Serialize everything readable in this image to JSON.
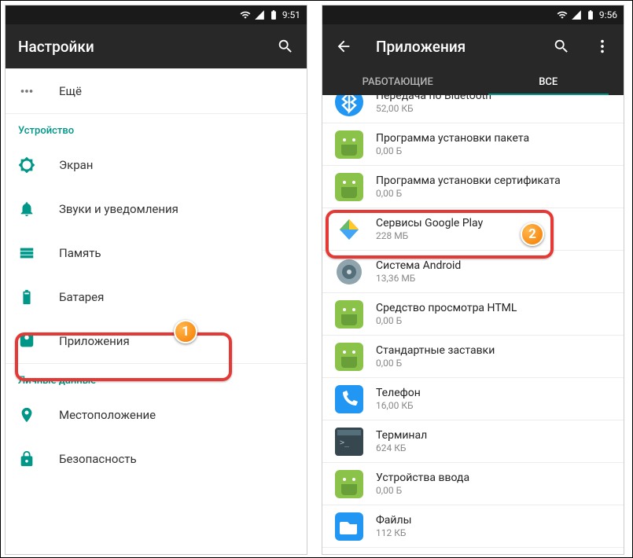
{
  "left": {
    "statusbar": {
      "time": "9:51"
    },
    "toolbar": {
      "title": "Настройки"
    },
    "list": {
      "more_label": "Ещё",
      "section_device": "Устройство",
      "items_device": [
        {
          "label": "Экран"
        },
        {
          "label": "Звуки и уведомления"
        },
        {
          "label": "Память"
        },
        {
          "label": "Батарея"
        },
        {
          "label": "Приложения"
        }
      ],
      "section_personal": "Личные данные",
      "items_personal": [
        {
          "label": "Местоположение"
        },
        {
          "label": "Безопасность"
        }
      ]
    },
    "callout": "1"
  },
  "right": {
    "statusbar": {
      "time": "9:56"
    },
    "toolbar": {
      "title": "Приложения"
    },
    "tabs": {
      "running": "РАБОТАЮЩИЕ",
      "all": "ВСЕ"
    },
    "apps": [
      {
        "name": "Передача по Bluetooth",
        "size": "52,00 КБ",
        "icon": "bluetooth"
      },
      {
        "name": "Программа установки пакета",
        "size": "0,00 Б",
        "icon": "android"
      },
      {
        "name": "Программа установки сертификата",
        "size": "0,00 Б",
        "icon": "android"
      },
      {
        "name": "Сервисы Google Play",
        "size": "228 МБ",
        "icon": "play"
      },
      {
        "name": "Система Android",
        "size": "13,36 МБ",
        "icon": "system"
      },
      {
        "name": "Средство просмотра HTML",
        "size": "0,00 Б",
        "icon": "android"
      },
      {
        "name": "Стандартные заставки",
        "size": "0,00 Б",
        "icon": "android"
      },
      {
        "name": "Телефон",
        "size": "16,00 КБ",
        "icon": "phone"
      },
      {
        "name": "Терминал",
        "size": "624 КБ",
        "icon": "terminal"
      },
      {
        "name": "Устройства ввода",
        "size": "0,00 Б",
        "icon": "android"
      },
      {
        "name": "Файлы",
        "size": "112 КБ",
        "icon": "files"
      }
    ],
    "callout": "2"
  }
}
